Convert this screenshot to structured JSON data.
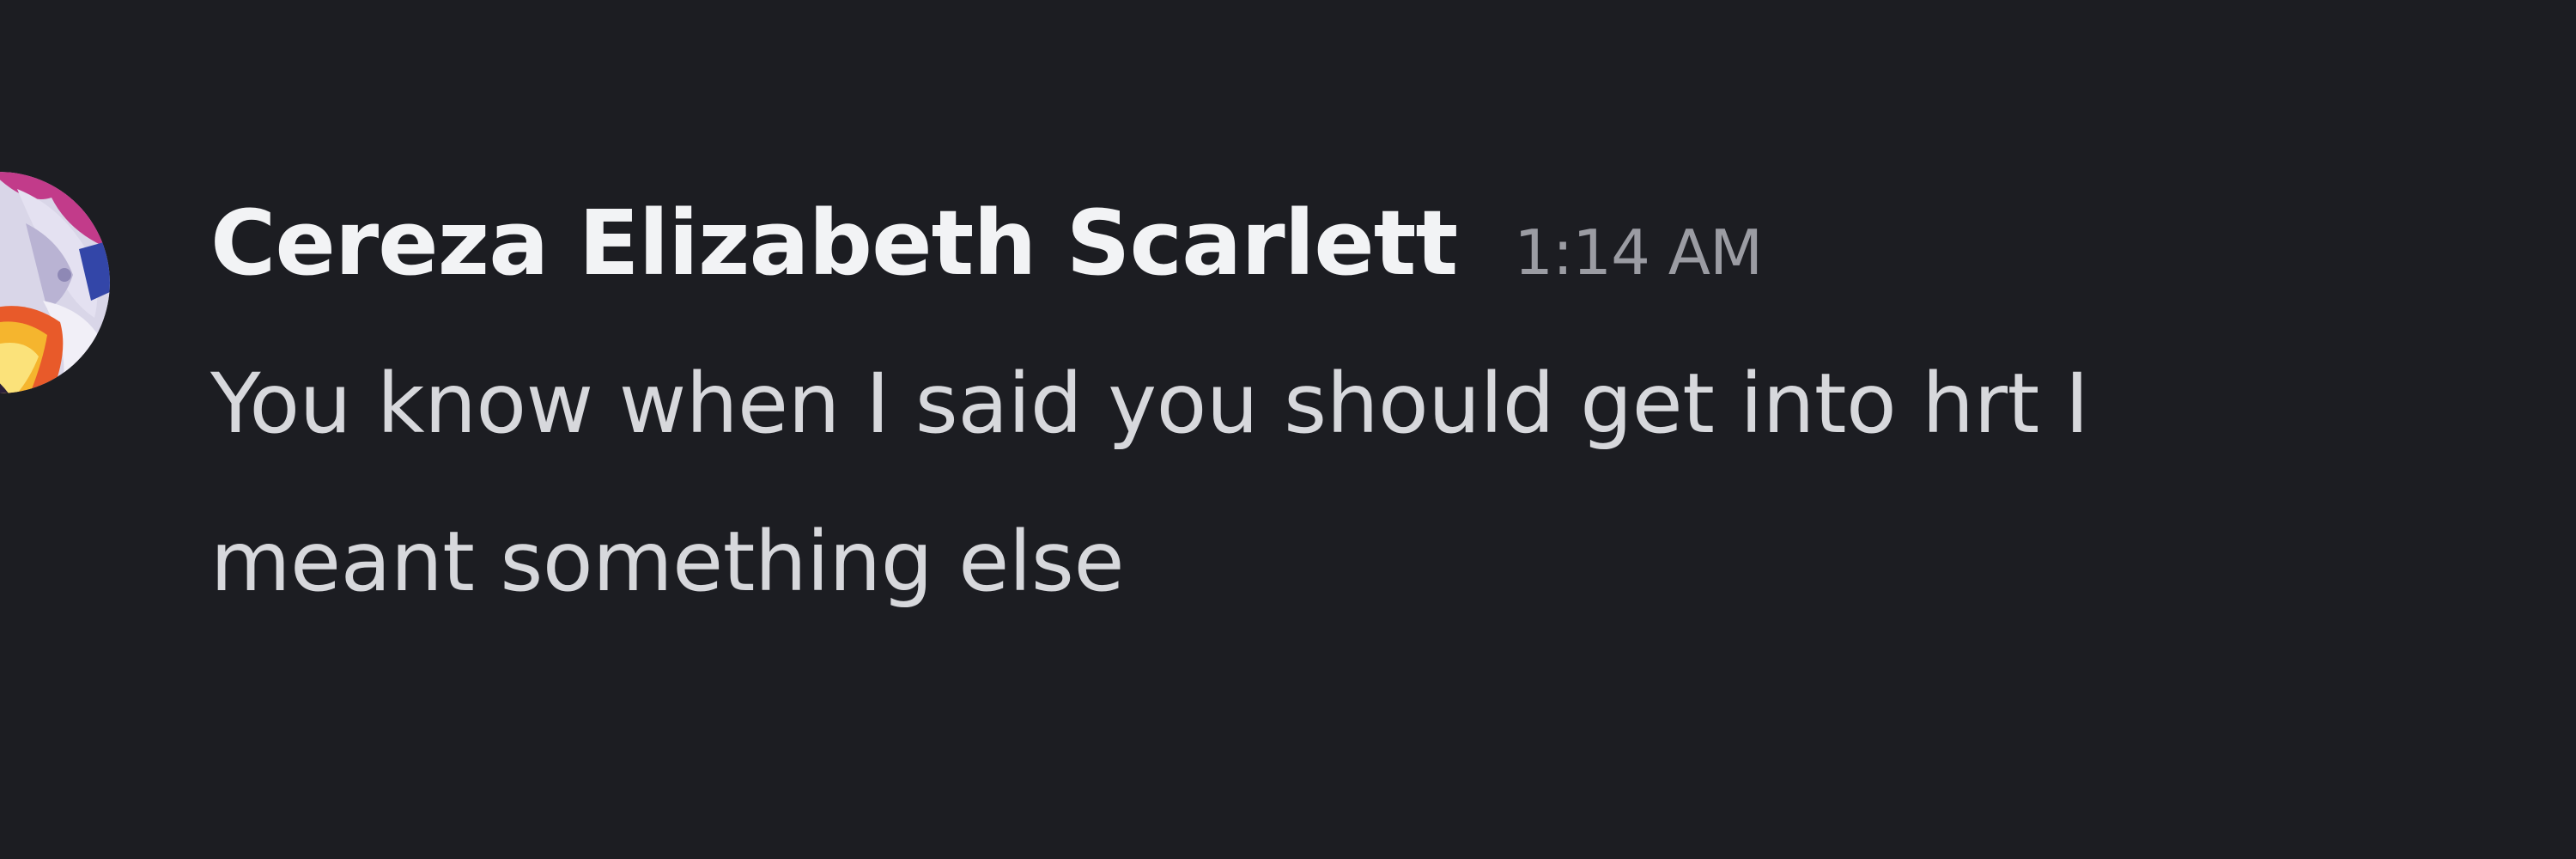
{
  "message": {
    "author": "Cereza Elizabeth Scarlett",
    "timestamp": "1:14 AM",
    "lines": [
      "You know when I said you should get into hrt I",
      "meant something else"
    ]
  },
  "icons": {
    "avatar": "anime-character-avatar"
  },
  "colors": {
    "background": "#1c1d22",
    "username": "#f2f3f5",
    "timestamp": "#9b9ca3",
    "message_text": "#d7d8dc"
  }
}
